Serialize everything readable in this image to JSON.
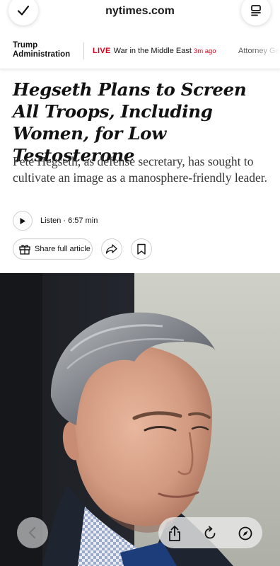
{
  "browser": {
    "url": "nytimes.com",
    "done_icon": "checkmark-icon",
    "menu_icon": "page-menu-icon"
  },
  "nav": {
    "section_label": "Trump\nAdministration",
    "live_tag": "LIVE",
    "live_text": "War in the Middle East",
    "live_time": "3m ago",
    "next_item": "Attorney Ge"
  },
  "article": {
    "headline": "Hegseth Plans to Screen All Troops, Including Women, for Low Testosterone",
    "summary": "Pete Hegseth, as defense secretary, has sought to cultivate an image as a manosphere-friendly leader.",
    "listen_label": "Listen · 6:57 min",
    "share_label": "Share full article"
  },
  "toolbar": {
    "back_icon": "chevron-left-icon",
    "share_icon": "share-icon",
    "reload_icon": "reload-icon",
    "compass_icon": "compass-icon"
  },
  "colors": {
    "live_red": "#d0021b",
    "text": "#121212"
  }
}
